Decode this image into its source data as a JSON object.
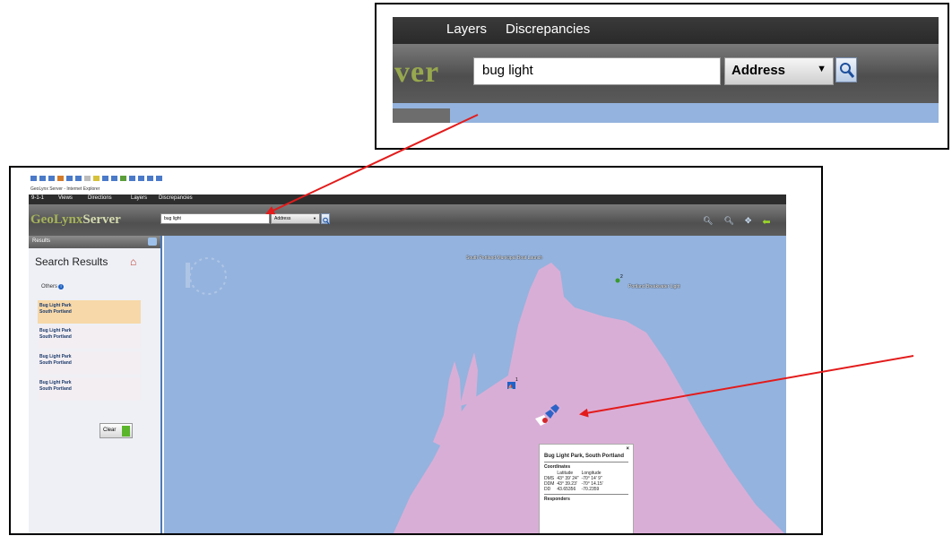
{
  "inset": {
    "menu": [
      "Layers",
      "Discrepancies"
    ],
    "brand_fragment": "ver",
    "search_value": "bug light",
    "search_type": "Address"
  },
  "main": {
    "window_title": "GeoLynx Server - Internet Explorer",
    "menu": [
      "9-1-1",
      "Views",
      "Directions",
      "Layers",
      "Discrepancies"
    ],
    "brand_geo": "GeoLynx",
    "brand_server": "Server",
    "search_value": "bug light",
    "search_type": "Address",
    "panel": {
      "header": "Results",
      "title": "Search Results",
      "group_label": "Others",
      "results": [
        {
          "line1": "Bug Light Park",
          "line2": "South Portland"
        },
        {
          "line1": "Bug Light Park",
          "line2": "South Portland"
        },
        {
          "line1": "Bug Light Park",
          "line2": "South Portland"
        },
        {
          "line1": "Bug Light Park",
          "line2": "South Portland"
        }
      ],
      "clear_label": "Clear"
    },
    "map": {
      "label_launch": "South Portland Municipal Boat Launch",
      "label_lighthouse": "Portland Breakwater Light",
      "marker_num_1": "1",
      "marker_num_2": "2",
      "popup": {
        "title": "Bug Light Park, South Portland",
        "coordinates_heading": "Coordinates",
        "col_latitude": "Latitude",
        "col_longitude": "Longitude",
        "rows": [
          {
            "label": "DMS",
            "lat": "43° 39' 24\"",
            "lon": "-70° 14' 9\""
          },
          {
            "label": "DDM",
            "lat": "43° 39.23'",
            "lon": "-70° 14.15'"
          },
          {
            "label": "DD",
            "lat": "43.65356",
            "lon": "-70.2359"
          }
        ],
        "responders_heading": "Responders"
      }
    }
  },
  "colors": {
    "map_water": "#94b3de",
    "map_land": "#d9aed6",
    "annotation_arrow": "#e31b1b",
    "brand_green": "#a6b35a",
    "selected_result": "#f7d8a8"
  }
}
